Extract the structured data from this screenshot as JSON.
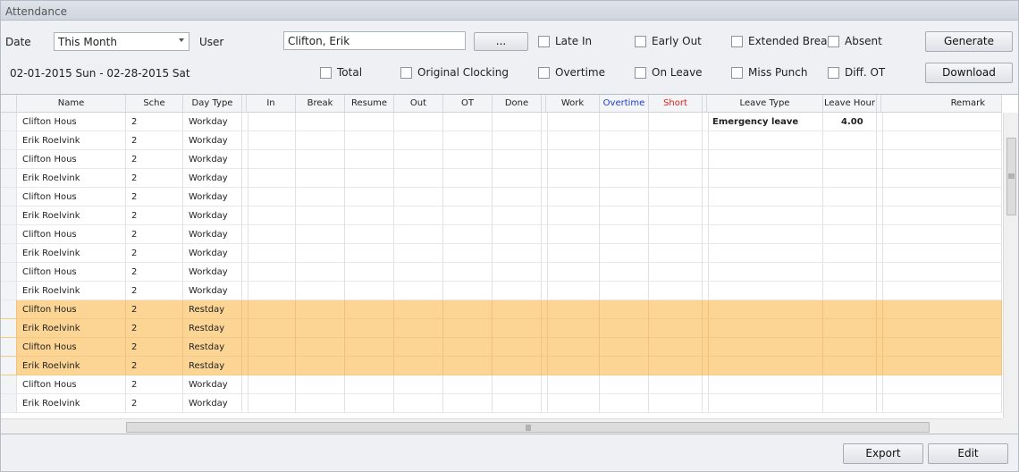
{
  "window": {
    "title": "Attendance"
  },
  "filters": {
    "date_label": "Date",
    "date_value": "This Month",
    "user_label": "User",
    "user_value": "Clifton, Erik",
    "browse_label": "...",
    "range_text": "02-01-2015 Sun - 02-28-2015 Sat"
  },
  "checkboxes": {
    "late_in": "Late In",
    "early_out": "Early Out",
    "extended_break": "Extended Break",
    "absent": "Absent",
    "total": "Total",
    "original_clocking": "Original Clocking",
    "overtime": "Overtime",
    "on_leave": "On Leave",
    "miss_punch": "Miss Punch",
    "diff_ot": "Diff. OT"
  },
  "buttons": {
    "generate": "Generate",
    "download": "Download",
    "export": "Export",
    "edit": "Edit"
  },
  "grid": {
    "columns": [
      "Name",
      "Sche",
      "Day Type",
      "In",
      "Break",
      "Resume",
      "Out",
      "OT",
      "Done",
      "Work",
      "Overtime",
      "Short",
      "Leave Type",
      "Leave Hour",
      "Remark"
    ],
    "column_colors": {
      "Overtime": "#1a3ccf",
      "Short": "#e02020"
    },
    "restday_color": "#fcd594",
    "rows": [
      {
        "name": "Clifton Hous",
        "sche": "2",
        "day_type": "Workday",
        "leave_type": "Emergency leave",
        "leave_hour": "4.00"
      },
      {
        "name": "Erik Roelvink",
        "sche": "2",
        "day_type": "Workday",
        "leave_type": "",
        "leave_hour": ""
      },
      {
        "name": "Clifton Hous",
        "sche": "2",
        "day_type": "Workday",
        "leave_type": "",
        "leave_hour": ""
      },
      {
        "name": "Erik Roelvink",
        "sche": "2",
        "day_type": "Workday",
        "leave_type": "",
        "leave_hour": ""
      },
      {
        "name": "Clifton Hous",
        "sche": "2",
        "day_type": "Workday",
        "leave_type": "",
        "leave_hour": ""
      },
      {
        "name": "Erik Roelvink",
        "sche": "2",
        "day_type": "Workday",
        "leave_type": "",
        "leave_hour": ""
      },
      {
        "name": "Clifton Hous",
        "sche": "2",
        "day_type": "Workday",
        "leave_type": "",
        "leave_hour": ""
      },
      {
        "name": "Erik Roelvink",
        "sche": "2",
        "day_type": "Workday",
        "leave_type": "",
        "leave_hour": ""
      },
      {
        "name": "Clifton Hous",
        "sche": "2",
        "day_type": "Workday",
        "leave_type": "",
        "leave_hour": ""
      },
      {
        "name": "Erik Roelvink",
        "sche": "2",
        "day_type": "Workday",
        "leave_type": "",
        "leave_hour": ""
      },
      {
        "name": "Clifton Hous",
        "sche": "2",
        "day_type": "Restday",
        "leave_type": "",
        "leave_hour": ""
      },
      {
        "name": "Erik Roelvink",
        "sche": "2",
        "day_type": "Restday",
        "leave_type": "",
        "leave_hour": ""
      },
      {
        "name": "Clifton Hous",
        "sche": "2",
        "day_type": "Restday",
        "leave_type": "",
        "leave_hour": ""
      },
      {
        "name": "Erik Roelvink",
        "sche": "2",
        "day_type": "Restday",
        "leave_type": "",
        "leave_hour": ""
      },
      {
        "name": "Clifton Hous",
        "sche": "2",
        "day_type": "Workday",
        "leave_type": "",
        "leave_hour": ""
      },
      {
        "name": "Erik Roelvink",
        "sche": "2",
        "day_type": "Workday",
        "leave_type": "",
        "leave_hour": ""
      }
    ]
  }
}
